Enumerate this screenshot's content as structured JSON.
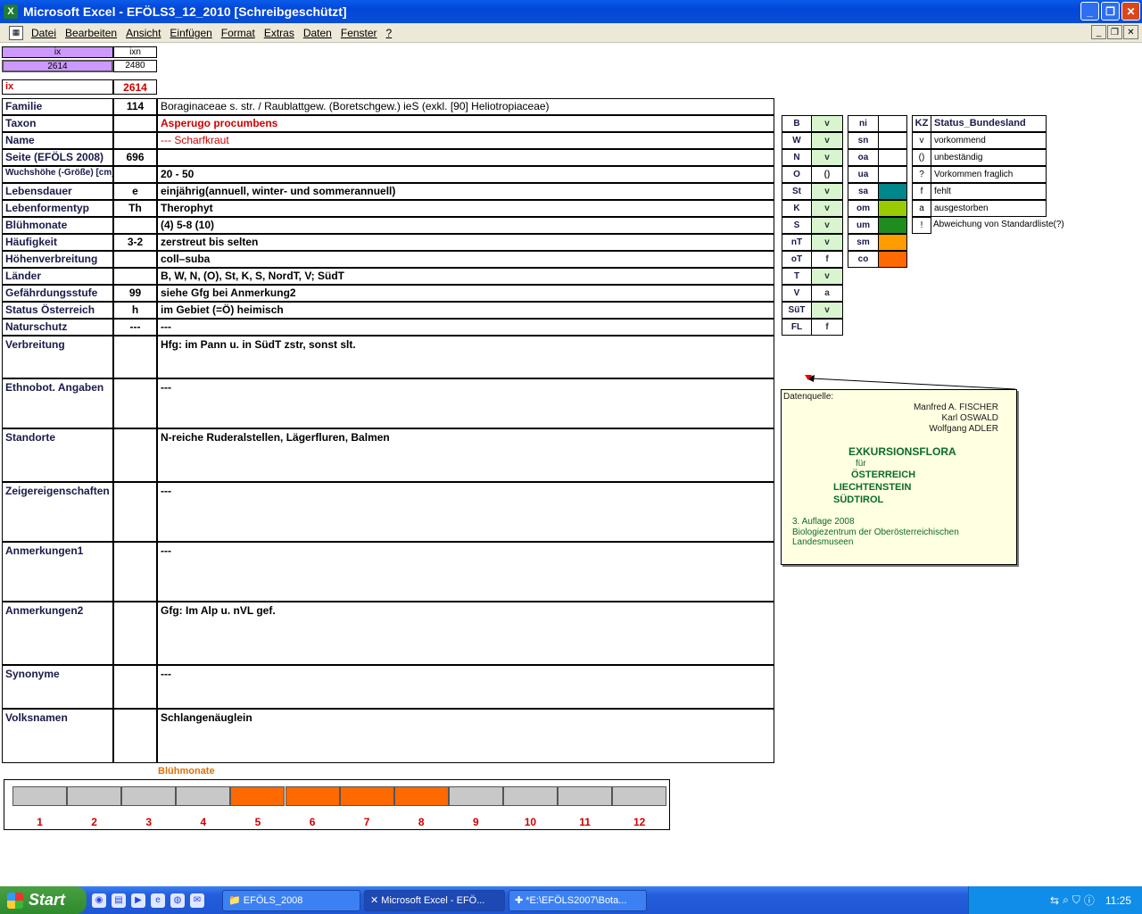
{
  "window": {
    "title": "Microsoft Excel - EFÖLS3_12_2010  [Schreibgeschützt]",
    "min": "_",
    "max": "❐",
    "close": "✕"
  },
  "menu": [
    "Datei",
    "Bearbeiten",
    "Ansicht",
    "Einfügen",
    "Format",
    "Extras",
    "Daten",
    "Fenster",
    "?"
  ],
  "header": {
    "ix_label1": "ix",
    "ixn_label": "ixn",
    "ix_value1": "2614",
    "ixn_value": "2480",
    "ix_label2": "ix",
    "ix_value2": "2614"
  },
  "rows": [
    {
      "label": "Familie",
      "code": "114",
      "value": "Boraginaceae s. str.  /  Raublattgew. (Boretschgew.) ieS (exkl. [90] Heliotropiaceae)"
    },
    {
      "label": "Taxon",
      "code": "",
      "value": "Asperugo procumbens"
    },
    {
      "label": "Name",
      "code": "",
      "value": "--- Scharfkraut"
    },
    {
      "label": "Seite (EFÖLS 2008)",
      "code": "696",
      "value": ""
    },
    {
      "label": "Wuchshöhe (-Größe) [cm]",
      "code": "",
      "value": "20 - 50"
    },
    {
      "label": "Lebensdauer",
      "code": "e",
      "value": "einjährig(annuell, winter- und sommerannuell)"
    },
    {
      "label": "Lebenformentyp",
      "code": "Th",
      "value": "Therophyt"
    },
    {
      "label": "Blühmonate",
      "code": "",
      "value": "(4) 5-8 (10)"
    },
    {
      "label": "Häufigkeit",
      "code": "3-2",
      "value": "zerstreut bis selten"
    },
    {
      "label": "Höhenverbreitung",
      "code": "",
      "value": "coll–suba"
    },
    {
      "label": "Länder",
      "code": "",
      "value": "B, W, N, (O), St, K, S, NordT, V; SüdT"
    },
    {
      "label": "Gefährdungsstufe",
      "code": "99",
      "value": "siehe Gfg bei Anmerkung2"
    },
    {
      "label": "Status Österreich",
      "code": "h",
      "value": "im Gebiet (=Ö) heimisch"
    },
    {
      "label": "Naturschutz",
      "code": "---",
      "value": "---"
    }
  ],
  "tall_rows": [
    {
      "label": "Verbreitung",
      "value": "Hfg: im Pann u. in SüdT zstr, sonst slt."
    },
    {
      "label": "Ethnobot. Angaben",
      "value": "---"
    },
    {
      "label": "Standorte",
      "value": "N-reiche Ruderalstellen, Lägerfluren, Balmen"
    },
    {
      "label": "Zeigereigenschaften",
      "value": "---"
    },
    {
      "label": "Anmerkungen1",
      "value": "---"
    },
    {
      "label": "Anmerkungen2",
      "value": "Gfg:  Im Alp u. nVL gef."
    },
    {
      "label": "Synonyme",
      "value": "---"
    },
    {
      "label": "Volksnamen",
      "value": "Schlangenäuglein"
    }
  ],
  "laender": [
    {
      "k": "B",
      "v": "v"
    },
    {
      "k": "W",
      "v": "v"
    },
    {
      "k": "N",
      "v": "v"
    },
    {
      "k": "O",
      "v": "()"
    },
    {
      "k": "St",
      "v": "v"
    },
    {
      "k": "K",
      "v": "v"
    },
    {
      "k": "S",
      "v": "v"
    },
    {
      "k": "nT",
      "v": "v"
    },
    {
      "k": "oT",
      "v": "f"
    },
    {
      "k": "T",
      "v": "v"
    },
    {
      "k": "V",
      "v": "a"
    },
    {
      "k": "SüT",
      "v": "v"
    },
    {
      "k": "FL",
      "v": "f"
    }
  ],
  "hoehen": [
    {
      "k": "ni",
      "color": ""
    },
    {
      "k": "sn",
      "color": ""
    },
    {
      "k": "oa",
      "color": ""
    },
    {
      "k": "ua",
      "color": ""
    },
    {
      "k": "sa",
      "color": "#00868b"
    },
    {
      "k": "om",
      "color": "#99cc00"
    },
    {
      "k": "um",
      "color": "#1e8c1e"
    },
    {
      "k": "sm",
      "color": "#ff9c00"
    },
    {
      "k": "co",
      "color": "#ff6a00"
    }
  ],
  "status_legend": {
    "header_kz": "KZ",
    "header_title": "Status_Bundesland",
    "items": [
      {
        "kz": "v",
        "text": "vorkommend"
      },
      {
        "kz": "()",
        "text": "unbeständig"
      },
      {
        "kz": "?",
        "text": "Vorkommen fraglich"
      },
      {
        "kz": "f",
        "text": "fehlt"
      },
      {
        "kz": "a",
        "text": "ausgestorben"
      },
      {
        "kz": "!",
        "text": "Abweichung von Standardliste(?)"
      }
    ]
  },
  "note": {
    "source": "Datenquelle:",
    "authors": [
      "Manfred A. FISCHER",
      "Karl OSWALD",
      "Wolfgang ADLER"
    ],
    "title1": "EXKURSIONSFLORA",
    "fuer": "für",
    "countries": [
      "ÖSTERREICH",
      "LIECHTENSTEIN",
      "SÜDTIROL"
    ],
    "edition": "3. Auflage 2008",
    "publisher": "Biologiezentrum der Oberösterreichischen Landesmuseen"
  },
  "bluehmonate_chart": {
    "title": "Blühmonate",
    "months": [
      "1",
      "2",
      "3",
      "4",
      "5",
      "6",
      "7",
      "8",
      "9",
      "10",
      "11",
      "12"
    ],
    "flowering": [
      0,
      0,
      0,
      0,
      1,
      1,
      1,
      1,
      0,
      0,
      0,
      0
    ],
    "on_color": "#ff6a00",
    "off_color": "#c8c8c8"
  },
  "taskbar": {
    "start": "Start",
    "tasks": [
      "EFÖLS_2008",
      "Microsoft Excel - EFÖ...",
      "*E:\\EFÖLS2007\\Bota..."
    ],
    "clock": "11:25"
  }
}
